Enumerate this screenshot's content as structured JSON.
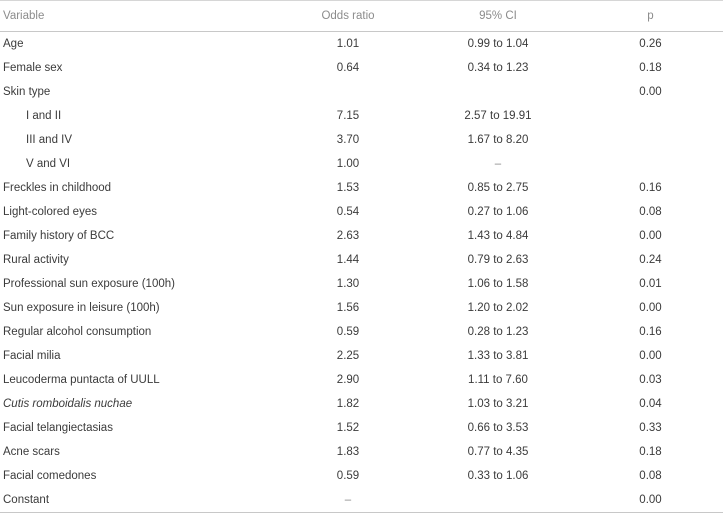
{
  "table": {
    "columns": [
      {
        "key": "variable",
        "label": "Variable",
        "align": "left"
      },
      {
        "key": "odds_ratio",
        "label": "Odds ratio",
        "align": "center"
      },
      {
        "key": "ci",
        "label": "95% CI",
        "align": "center"
      },
      {
        "key": "p",
        "label": "p",
        "align": "center"
      }
    ],
    "rows": [
      {
        "variable": "Age",
        "odds_ratio": "1.01",
        "ci": "0.99 to 1.04",
        "p": "0.26",
        "indent": false,
        "italic": false
      },
      {
        "variable": "Female sex",
        "odds_ratio": "0.64",
        "ci": "0.34 to 1.23",
        "p": "0.18",
        "indent": false,
        "italic": false
      },
      {
        "variable": "Skin type",
        "odds_ratio": "",
        "ci": "",
        "p": "0.00",
        "indent": false,
        "italic": false
      },
      {
        "variable": "I and II",
        "odds_ratio": "7.15",
        "ci": "2.57 to 19.91",
        "p": "",
        "indent": true,
        "italic": false
      },
      {
        "variable": "III and IV",
        "odds_ratio": "3.70",
        "ci": "1.67 to 8.20",
        "p": "",
        "indent": true,
        "italic": false
      },
      {
        "variable": "V and VI",
        "odds_ratio": "1.00",
        "ci": "–",
        "p": "",
        "indent": true,
        "italic": false
      },
      {
        "variable": "Freckles in childhood",
        "odds_ratio": "1.53",
        "ci": "0.85 to 2.75",
        "p": "0.16",
        "indent": false,
        "italic": false
      },
      {
        "variable": "Light-colored eyes",
        "odds_ratio": "0.54",
        "ci": "0.27 to 1.06",
        "p": "0.08",
        "indent": false,
        "italic": false
      },
      {
        "variable": "Family history of BCC",
        "odds_ratio": "2.63",
        "ci": "1.43 to 4.84",
        "p": "0.00",
        "indent": false,
        "italic": false
      },
      {
        "variable": "Rural activity",
        "odds_ratio": "1.44",
        "ci": "0.79 to 2.63",
        "p": "0.24",
        "indent": false,
        "italic": false
      },
      {
        "variable": "Professional sun exposure (100h)",
        "odds_ratio": "1.30",
        "ci": "1.06 to 1.58",
        "p": "0.01",
        "indent": false,
        "italic": false
      },
      {
        "variable": "Sun exposure in leisure (100h)",
        "odds_ratio": "1.56",
        "ci": "1.20 to 2.02",
        "p": "0.00",
        "indent": false,
        "italic": false
      },
      {
        "variable": "Regular alcohol consumption",
        "odds_ratio": "0.59",
        "ci": "0.28 to 1.23",
        "p": "0.16",
        "indent": false,
        "italic": false
      },
      {
        "variable": "Facial milia",
        "odds_ratio": "2.25",
        "ci": "1.33 to 3.81",
        "p": "0.00",
        "indent": false,
        "italic": false
      },
      {
        "variable": "Leucoderma puntacta of UULL",
        "odds_ratio": "2.90",
        "ci": "1.11 to 7.60",
        "p": "0.03",
        "indent": false,
        "italic": false
      },
      {
        "variable": "Cutis romboidalis nuchae",
        "odds_ratio": "1.82",
        "ci": "1.03 to 3.21",
        "p": "0.04",
        "indent": false,
        "italic": true
      },
      {
        "variable": "Facial telangiectasias",
        "odds_ratio": "1.52",
        "ci": "0.66 to 3.53",
        "p": "0.33",
        "indent": false,
        "italic": false
      },
      {
        "variable": "Acne scars",
        "odds_ratio": "1.83",
        "ci": "0.77 to 4.35",
        "p": "0.18",
        "indent": false,
        "italic": false
      },
      {
        "variable": "Facial comedones",
        "odds_ratio": "0.59",
        "ci": "0.33 to 1.06",
        "p": "0.08",
        "indent": false,
        "italic": false
      },
      {
        "variable": "Constant",
        "odds_ratio": "–",
        "ci": "",
        "p": "0.00",
        "indent": false,
        "italic": false
      }
    ]
  },
  "colors": {
    "header_text": "#8c8c8c",
    "body_text": "#3b3b3b",
    "rule": "#c8c8c8"
  }
}
